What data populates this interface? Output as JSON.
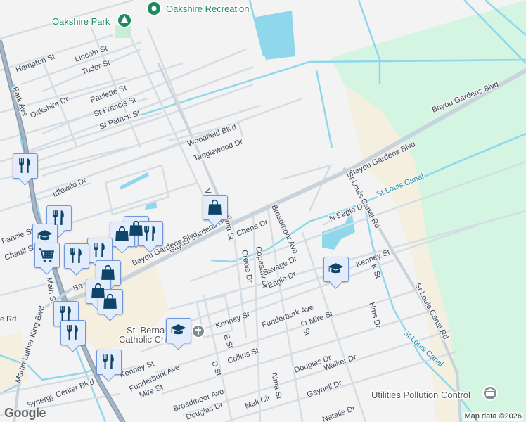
{
  "pois": {
    "oakshire_park": "Oakshire Park",
    "oakshire_recreation": "Oakshire Recreation",
    "st_bernadette": [
      "St. Berna",
      "Catholic Ch"
    ],
    "utilities": "Utilities Pollution Control"
  },
  "streets": {
    "hampton": "Hampton St",
    "lincoln": "Lincoln St",
    "tudor": "Tudor St",
    "park_ave": "Park Ave",
    "oakshire_dr": "Oakshire Dr",
    "paulette": "Paulette St",
    "st_francis": "St Francis St",
    "st_patrick": "St Patrick St",
    "woodfield": "Woodfield Blvd",
    "tanglewood": "Tanglewood Dr",
    "idlewild": "Idlewild Dr",
    "bayou1": "Bayou Gardens Blvd",
    "bayou2": "Bayou Gardens Blvd",
    "bayou3": "Bayou Gardens Blvd",
    "bayou4": "Bayou Gardens Blvd",
    "bayou5": "Ba",
    "fannie": "Fannie St",
    "chauff": "Chauff St",
    "main": "Main St",
    "mlk": "Martin Luther King Blvd",
    "e_rd": "e Rd",
    "alma1": "Alma St",
    "alma2": "Alma St",
    "chene": "Chene Dr",
    "creole": "Creole Dr",
    "copasaw": "Copasaw Dr",
    "broadmoor1": "Broadmoor Ave",
    "broadmoor2": "Broadmoor Ave",
    "savage": "Savage Dr",
    "eagle": "Eagle Dr",
    "n_eagle": "N Eagle Dr",
    "kenney1": "Kenney St",
    "kenney2": "Kenney St",
    "kenney3": "Kenney St",
    "k_st": "K St",
    "hms": "Hms Dr",
    "funderburk1": "Funderburk Ave",
    "funderburk2": "Funderburk Ave",
    "mire1": "Mire St",
    "mire2": "Mire St",
    "g_st": "G St",
    "e_st": "E St",
    "d_st": "D St",
    "collins": "Collins St",
    "douglas1": "Douglas Dr",
    "douglas2": "Douglas Dr",
    "walker": "Walker Dr",
    "gaynell": "Gaynell Dr",
    "mall_cir": "Mall Cir",
    "natalie": "Natalie Dr",
    "synergy": "Synergy Center Blvd",
    "st_louis_canal_rd1": "St Louis Canal Rd",
    "st_louis_canal_rd2": "St Louis Canal Rd",
    "v": "V"
  },
  "water": {
    "canal1": "St Louis Canal",
    "canal2": "St Louis Canal"
  },
  "markers": [
    {
      "icon": "restaurant"
    },
    {
      "icon": "restaurant"
    },
    {
      "icon": "school"
    },
    {
      "icon": "shopping"
    },
    {
      "icon": "restaurant"
    },
    {
      "icon": "shopping-cart"
    },
    {
      "icon": "restaurant"
    },
    {
      "icon": "restaurant"
    },
    {
      "icon": "shopping"
    },
    {
      "icon": "shopping"
    },
    {
      "icon": "restaurant"
    },
    {
      "icon": "restaurant"
    },
    {
      "icon": "restaurant"
    },
    {
      "icon": "school"
    },
    {
      "icon": "school"
    }
  ],
  "footer": {
    "google": "Google",
    "attribution": "Map data ©2026"
  },
  "colors": {
    "park": "#d3f5e2",
    "water": "#8fd8ec",
    "commercial": "#f5efe0",
    "marker_bg": "#e3ecfb",
    "marker_icon": "#0e4468"
  }
}
